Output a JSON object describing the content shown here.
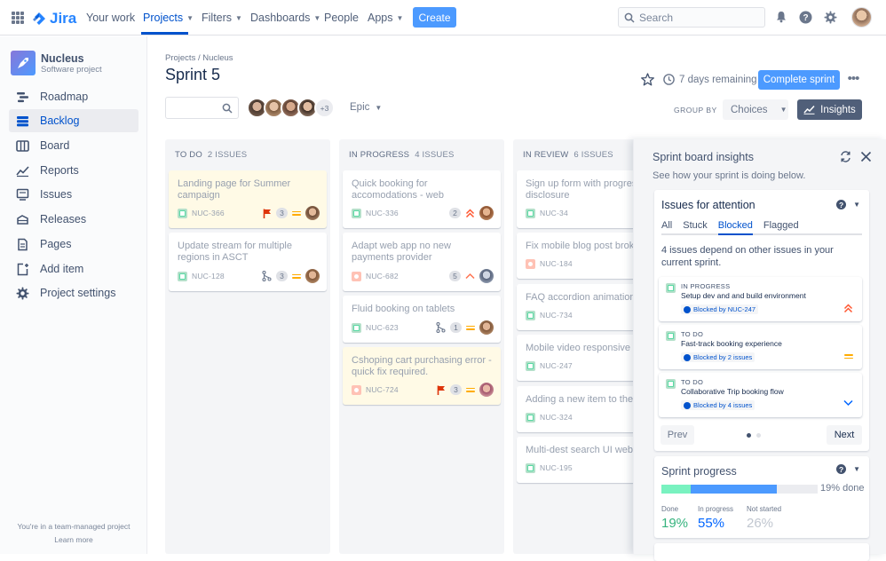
{
  "topnav": {
    "logo": "Jira",
    "items": [
      {
        "label": "Your work"
      },
      {
        "label": "Projects"
      },
      {
        "label": "Filters"
      },
      {
        "label": "Dashboards"
      },
      {
        "label": "People"
      },
      {
        "label": "Apps"
      }
    ],
    "create": "Create",
    "search_placeholder": "Search"
  },
  "sidebar": {
    "project_name": "Nucleus",
    "project_type": "Software project",
    "items": [
      {
        "label": "Roadmap"
      },
      {
        "label": "Backlog"
      },
      {
        "label": "Board"
      },
      {
        "label": "Reports"
      },
      {
        "label": "Issues"
      },
      {
        "label": "Releases"
      },
      {
        "label": "Pages"
      },
      {
        "label": "Add item"
      },
      {
        "label": "Project settings"
      }
    ],
    "footer_text": "You're in a team-managed project",
    "footer_link": "Learn more"
  },
  "header": {
    "breadcrumb": "Projects / Nucleus",
    "title": "Sprint 5",
    "remaining": "7 days remaining",
    "complete_button": "Complete sprint"
  },
  "toolbar": {
    "avatar_more": "+3",
    "epic": "Epic",
    "group_by": "GROUP BY",
    "choices": "Choices",
    "insights": "Insights"
  },
  "columns": [
    {
      "title": "TO DO",
      "count": "2 ISSUES",
      "cards": [
        {
          "title": "Landing page for Summer campaign",
          "key": "NUC-366",
          "type": "story",
          "points": "3"
        },
        {
          "title": "Update stream for multiple regions in ASCT",
          "key": "NUC-128",
          "type": "story",
          "points": "3"
        }
      ]
    },
    {
      "title": "IN PROGRESS",
      "count": "4 ISSUES",
      "cards": [
        {
          "title": "Quick booking for accomodations - web",
          "key": "NUC-336",
          "type": "story",
          "points": "2"
        },
        {
          "title": "Adapt web app no new payments provider",
          "key": "NUC-682",
          "type": "bug",
          "points": "5"
        },
        {
          "title": "Fluid booking on tablets",
          "key": "NUC-623",
          "type": "story",
          "points": "1"
        },
        {
          "title": "Cshoping cart purchasing error - quick fix required.",
          "key": "NUC-724",
          "type": "bug",
          "points": "3"
        }
      ]
    },
    {
      "title": "IN REVIEW",
      "count": "6 ISSUES",
      "cards": [
        {
          "title": "Sign up form with progressive disclosure",
          "key": "NUC-34",
          "type": "story",
          "points": "3"
        },
        {
          "title": "Fix mobile blog post broken",
          "key": "NUC-184",
          "type": "bug",
          "points": ""
        },
        {
          "title": "FAQ accordion animation",
          "key": "NUC-734",
          "type": "story",
          "points": "3"
        },
        {
          "title": "Mobile video responsive iframe",
          "key": "NUC-247",
          "type": "story",
          "points": "3"
        },
        {
          "title": "Adding a new item to the shop",
          "key": "NUC-324",
          "type": "story",
          "points": "3"
        },
        {
          "title": "Multi-dest search UI web",
          "key": "NUC-195",
          "type": "story",
          "points": "3"
        }
      ]
    }
  ],
  "insights": {
    "title": "Sprint board insights",
    "subtitle": "See how your sprint is doing below.",
    "attention": {
      "title": "Issues for attention",
      "tabs": [
        {
          "label": "All"
        },
        {
          "label": "Stuck"
        },
        {
          "label": "Blocked"
        },
        {
          "label": "Flagged"
        }
      ],
      "description": "4 issues depend on other issues in your current sprint.",
      "items": [
        {
          "status": "IN PROGRESS",
          "title": "Setup dev and and build environment",
          "blocked": "Blocked by NUC-247"
        },
        {
          "status": "TO DO",
          "title": "Fast-track booking experience",
          "blocked": "Blocked by 2 issues"
        },
        {
          "status": "TO DO",
          "title": "Collaborative Trip booking flow",
          "blocked": "Blocked by 4 issues"
        }
      ],
      "prev": "Prev",
      "next": "Next"
    },
    "progress": {
      "title": "Sprint progress",
      "done_fraction": 0.19,
      "in_progress_fraction": 0.55,
      "pct_label": "19% done",
      "stats": [
        {
          "label": "Done",
          "value": "19%",
          "color": "#36b37e"
        },
        {
          "label": "In progress",
          "value": "55%",
          "color": "#0065ff"
        },
        {
          "label": "Not started",
          "value": "26%",
          "color": "#c1c7d0"
        }
      ]
    }
  }
}
